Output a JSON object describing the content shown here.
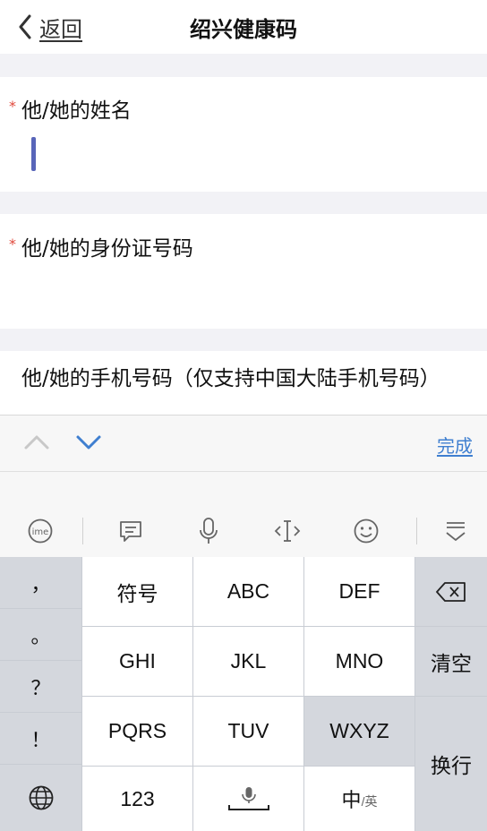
{
  "nav": {
    "back_label": "返回",
    "title": "绍兴健康码"
  },
  "form": {
    "name_label": "他/她的姓名",
    "id_label": "他/她的身份证号码",
    "phone_label": "他/她的手机号码（仅支持中国大陆手机号码）",
    "required_mark": "*"
  },
  "accessory": {
    "done_label": "完成"
  },
  "toolbar": {
    "icons": [
      "ime-icon",
      "message-icon",
      "microphone-icon",
      "text-cursor-icon",
      "emoji-icon",
      "hide-keyboard-icon"
    ]
  },
  "keyboard": {
    "punct": [
      "，",
      "。",
      "？",
      "！"
    ],
    "row1": [
      "符号",
      "ABC",
      "DEF"
    ],
    "row2": [
      "GHI",
      "JKL",
      "MNO"
    ],
    "row3": [
      "PQRS",
      "TUV",
      "WXYZ"
    ],
    "clear": "清空",
    "enter": "换行",
    "num": "123",
    "lang_main": "中",
    "lang_sub": "/英"
  },
  "colors": {
    "accent": "#3f7fd0",
    "required": "#e0483b",
    "cursor": "#5865b9"
  }
}
